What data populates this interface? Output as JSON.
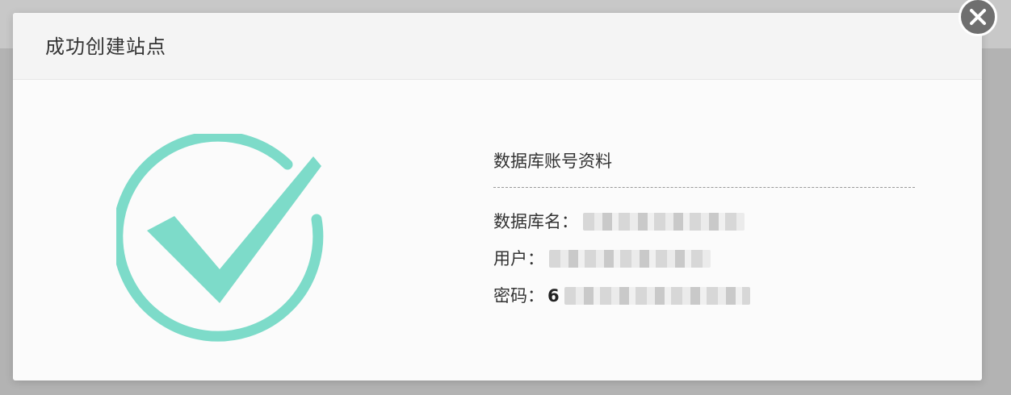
{
  "dialog": {
    "title": "成功创建站点",
    "close_icon": "close-icon"
  },
  "status_icon": "success-check-icon",
  "colors": {
    "accent": "#7ddbc9",
    "close_button": "#6f6f6f"
  },
  "database_info": {
    "title": "数据库账号资料",
    "db_name_label": "数据库名：",
    "user_label": "用户：",
    "password_label": "密码：",
    "password_visible_prefix": "6"
  }
}
